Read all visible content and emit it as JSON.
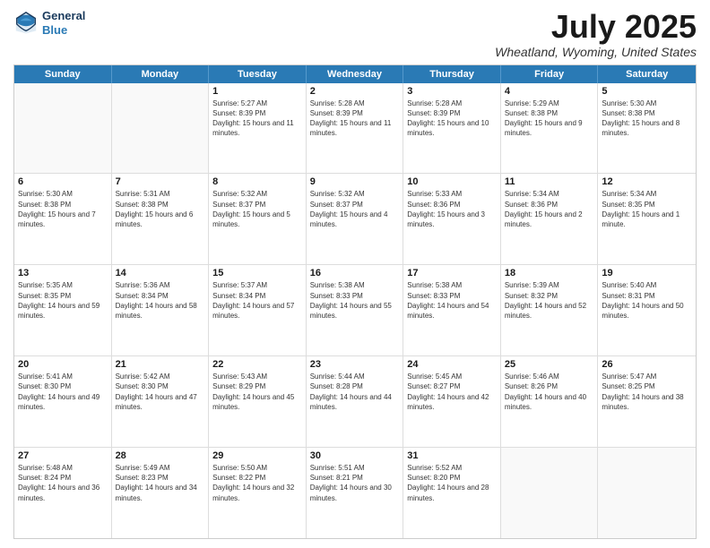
{
  "logo": {
    "line1": "General",
    "line2": "Blue"
  },
  "title": "July 2025",
  "subtitle": "Wheatland, Wyoming, United States",
  "days_of_week": [
    "Sunday",
    "Monday",
    "Tuesday",
    "Wednesday",
    "Thursday",
    "Friday",
    "Saturday"
  ],
  "weeks": [
    [
      {
        "day": "",
        "empty": true
      },
      {
        "day": "",
        "empty": true
      },
      {
        "day": "1",
        "sunrise": "Sunrise: 5:27 AM",
        "sunset": "Sunset: 8:39 PM",
        "daylight": "Daylight: 15 hours and 11 minutes."
      },
      {
        "day": "2",
        "sunrise": "Sunrise: 5:28 AM",
        "sunset": "Sunset: 8:39 PM",
        "daylight": "Daylight: 15 hours and 11 minutes."
      },
      {
        "day": "3",
        "sunrise": "Sunrise: 5:28 AM",
        "sunset": "Sunset: 8:39 PM",
        "daylight": "Daylight: 15 hours and 10 minutes."
      },
      {
        "day": "4",
        "sunrise": "Sunrise: 5:29 AM",
        "sunset": "Sunset: 8:38 PM",
        "daylight": "Daylight: 15 hours and 9 minutes."
      },
      {
        "day": "5",
        "sunrise": "Sunrise: 5:30 AM",
        "sunset": "Sunset: 8:38 PM",
        "daylight": "Daylight: 15 hours and 8 minutes."
      }
    ],
    [
      {
        "day": "6",
        "sunrise": "Sunrise: 5:30 AM",
        "sunset": "Sunset: 8:38 PM",
        "daylight": "Daylight: 15 hours and 7 minutes."
      },
      {
        "day": "7",
        "sunrise": "Sunrise: 5:31 AM",
        "sunset": "Sunset: 8:38 PM",
        "daylight": "Daylight: 15 hours and 6 minutes."
      },
      {
        "day": "8",
        "sunrise": "Sunrise: 5:32 AM",
        "sunset": "Sunset: 8:37 PM",
        "daylight": "Daylight: 15 hours and 5 minutes."
      },
      {
        "day": "9",
        "sunrise": "Sunrise: 5:32 AM",
        "sunset": "Sunset: 8:37 PM",
        "daylight": "Daylight: 15 hours and 4 minutes."
      },
      {
        "day": "10",
        "sunrise": "Sunrise: 5:33 AM",
        "sunset": "Sunset: 8:36 PM",
        "daylight": "Daylight: 15 hours and 3 minutes."
      },
      {
        "day": "11",
        "sunrise": "Sunrise: 5:34 AM",
        "sunset": "Sunset: 8:36 PM",
        "daylight": "Daylight: 15 hours and 2 minutes."
      },
      {
        "day": "12",
        "sunrise": "Sunrise: 5:34 AM",
        "sunset": "Sunset: 8:35 PM",
        "daylight": "Daylight: 15 hours and 1 minute."
      }
    ],
    [
      {
        "day": "13",
        "sunrise": "Sunrise: 5:35 AM",
        "sunset": "Sunset: 8:35 PM",
        "daylight": "Daylight: 14 hours and 59 minutes."
      },
      {
        "day": "14",
        "sunrise": "Sunrise: 5:36 AM",
        "sunset": "Sunset: 8:34 PM",
        "daylight": "Daylight: 14 hours and 58 minutes."
      },
      {
        "day": "15",
        "sunrise": "Sunrise: 5:37 AM",
        "sunset": "Sunset: 8:34 PM",
        "daylight": "Daylight: 14 hours and 57 minutes."
      },
      {
        "day": "16",
        "sunrise": "Sunrise: 5:38 AM",
        "sunset": "Sunset: 8:33 PM",
        "daylight": "Daylight: 14 hours and 55 minutes."
      },
      {
        "day": "17",
        "sunrise": "Sunrise: 5:38 AM",
        "sunset": "Sunset: 8:33 PM",
        "daylight": "Daylight: 14 hours and 54 minutes."
      },
      {
        "day": "18",
        "sunrise": "Sunrise: 5:39 AM",
        "sunset": "Sunset: 8:32 PM",
        "daylight": "Daylight: 14 hours and 52 minutes."
      },
      {
        "day": "19",
        "sunrise": "Sunrise: 5:40 AM",
        "sunset": "Sunset: 8:31 PM",
        "daylight": "Daylight: 14 hours and 50 minutes."
      }
    ],
    [
      {
        "day": "20",
        "sunrise": "Sunrise: 5:41 AM",
        "sunset": "Sunset: 8:30 PM",
        "daylight": "Daylight: 14 hours and 49 minutes."
      },
      {
        "day": "21",
        "sunrise": "Sunrise: 5:42 AM",
        "sunset": "Sunset: 8:30 PM",
        "daylight": "Daylight: 14 hours and 47 minutes."
      },
      {
        "day": "22",
        "sunrise": "Sunrise: 5:43 AM",
        "sunset": "Sunset: 8:29 PM",
        "daylight": "Daylight: 14 hours and 45 minutes."
      },
      {
        "day": "23",
        "sunrise": "Sunrise: 5:44 AM",
        "sunset": "Sunset: 8:28 PM",
        "daylight": "Daylight: 14 hours and 44 minutes."
      },
      {
        "day": "24",
        "sunrise": "Sunrise: 5:45 AM",
        "sunset": "Sunset: 8:27 PM",
        "daylight": "Daylight: 14 hours and 42 minutes."
      },
      {
        "day": "25",
        "sunrise": "Sunrise: 5:46 AM",
        "sunset": "Sunset: 8:26 PM",
        "daylight": "Daylight: 14 hours and 40 minutes."
      },
      {
        "day": "26",
        "sunrise": "Sunrise: 5:47 AM",
        "sunset": "Sunset: 8:25 PM",
        "daylight": "Daylight: 14 hours and 38 minutes."
      }
    ],
    [
      {
        "day": "27",
        "sunrise": "Sunrise: 5:48 AM",
        "sunset": "Sunset: 8:24 PM",
        "daylight": "Daylight: 14 hours and 36 minutes."
      },
      {
        "day": "28",
        "sunrise": "Sunrise: 5:49 AM",
        "sunset": "Sunset: 8:23 PM",
        "daylight": "Daylight: 14 hours and 34 minutes."
      },
      {
        "day": "29",
        "sunrise": "Sunrise: 5:50 AM",
        "sunset": "Sunset: 8:22 PM",
        "daylight": "Daylight: 14 hours and 32 minutes."
      },
      {
        "day": "30",
        "sunrise": "Sunrise: 5:51 AM",
        "sunset": "Sunset: 8:21 PM",
        "daylight": "Daylight: 14 hours and 30 minutes."
      },
      {
        "day": "31",
        "sunrise": "Sunrise: 5:52 AM",
        "sunset": "Sunset: 8:20 PM",
        "daylight": "Daylight: 14 hours and 28 minutes."
      },
      {
        "day": "",
        "empty": true
      },
      {
        "day": "",
        "empty": true
      }
    ]
  ]
}
